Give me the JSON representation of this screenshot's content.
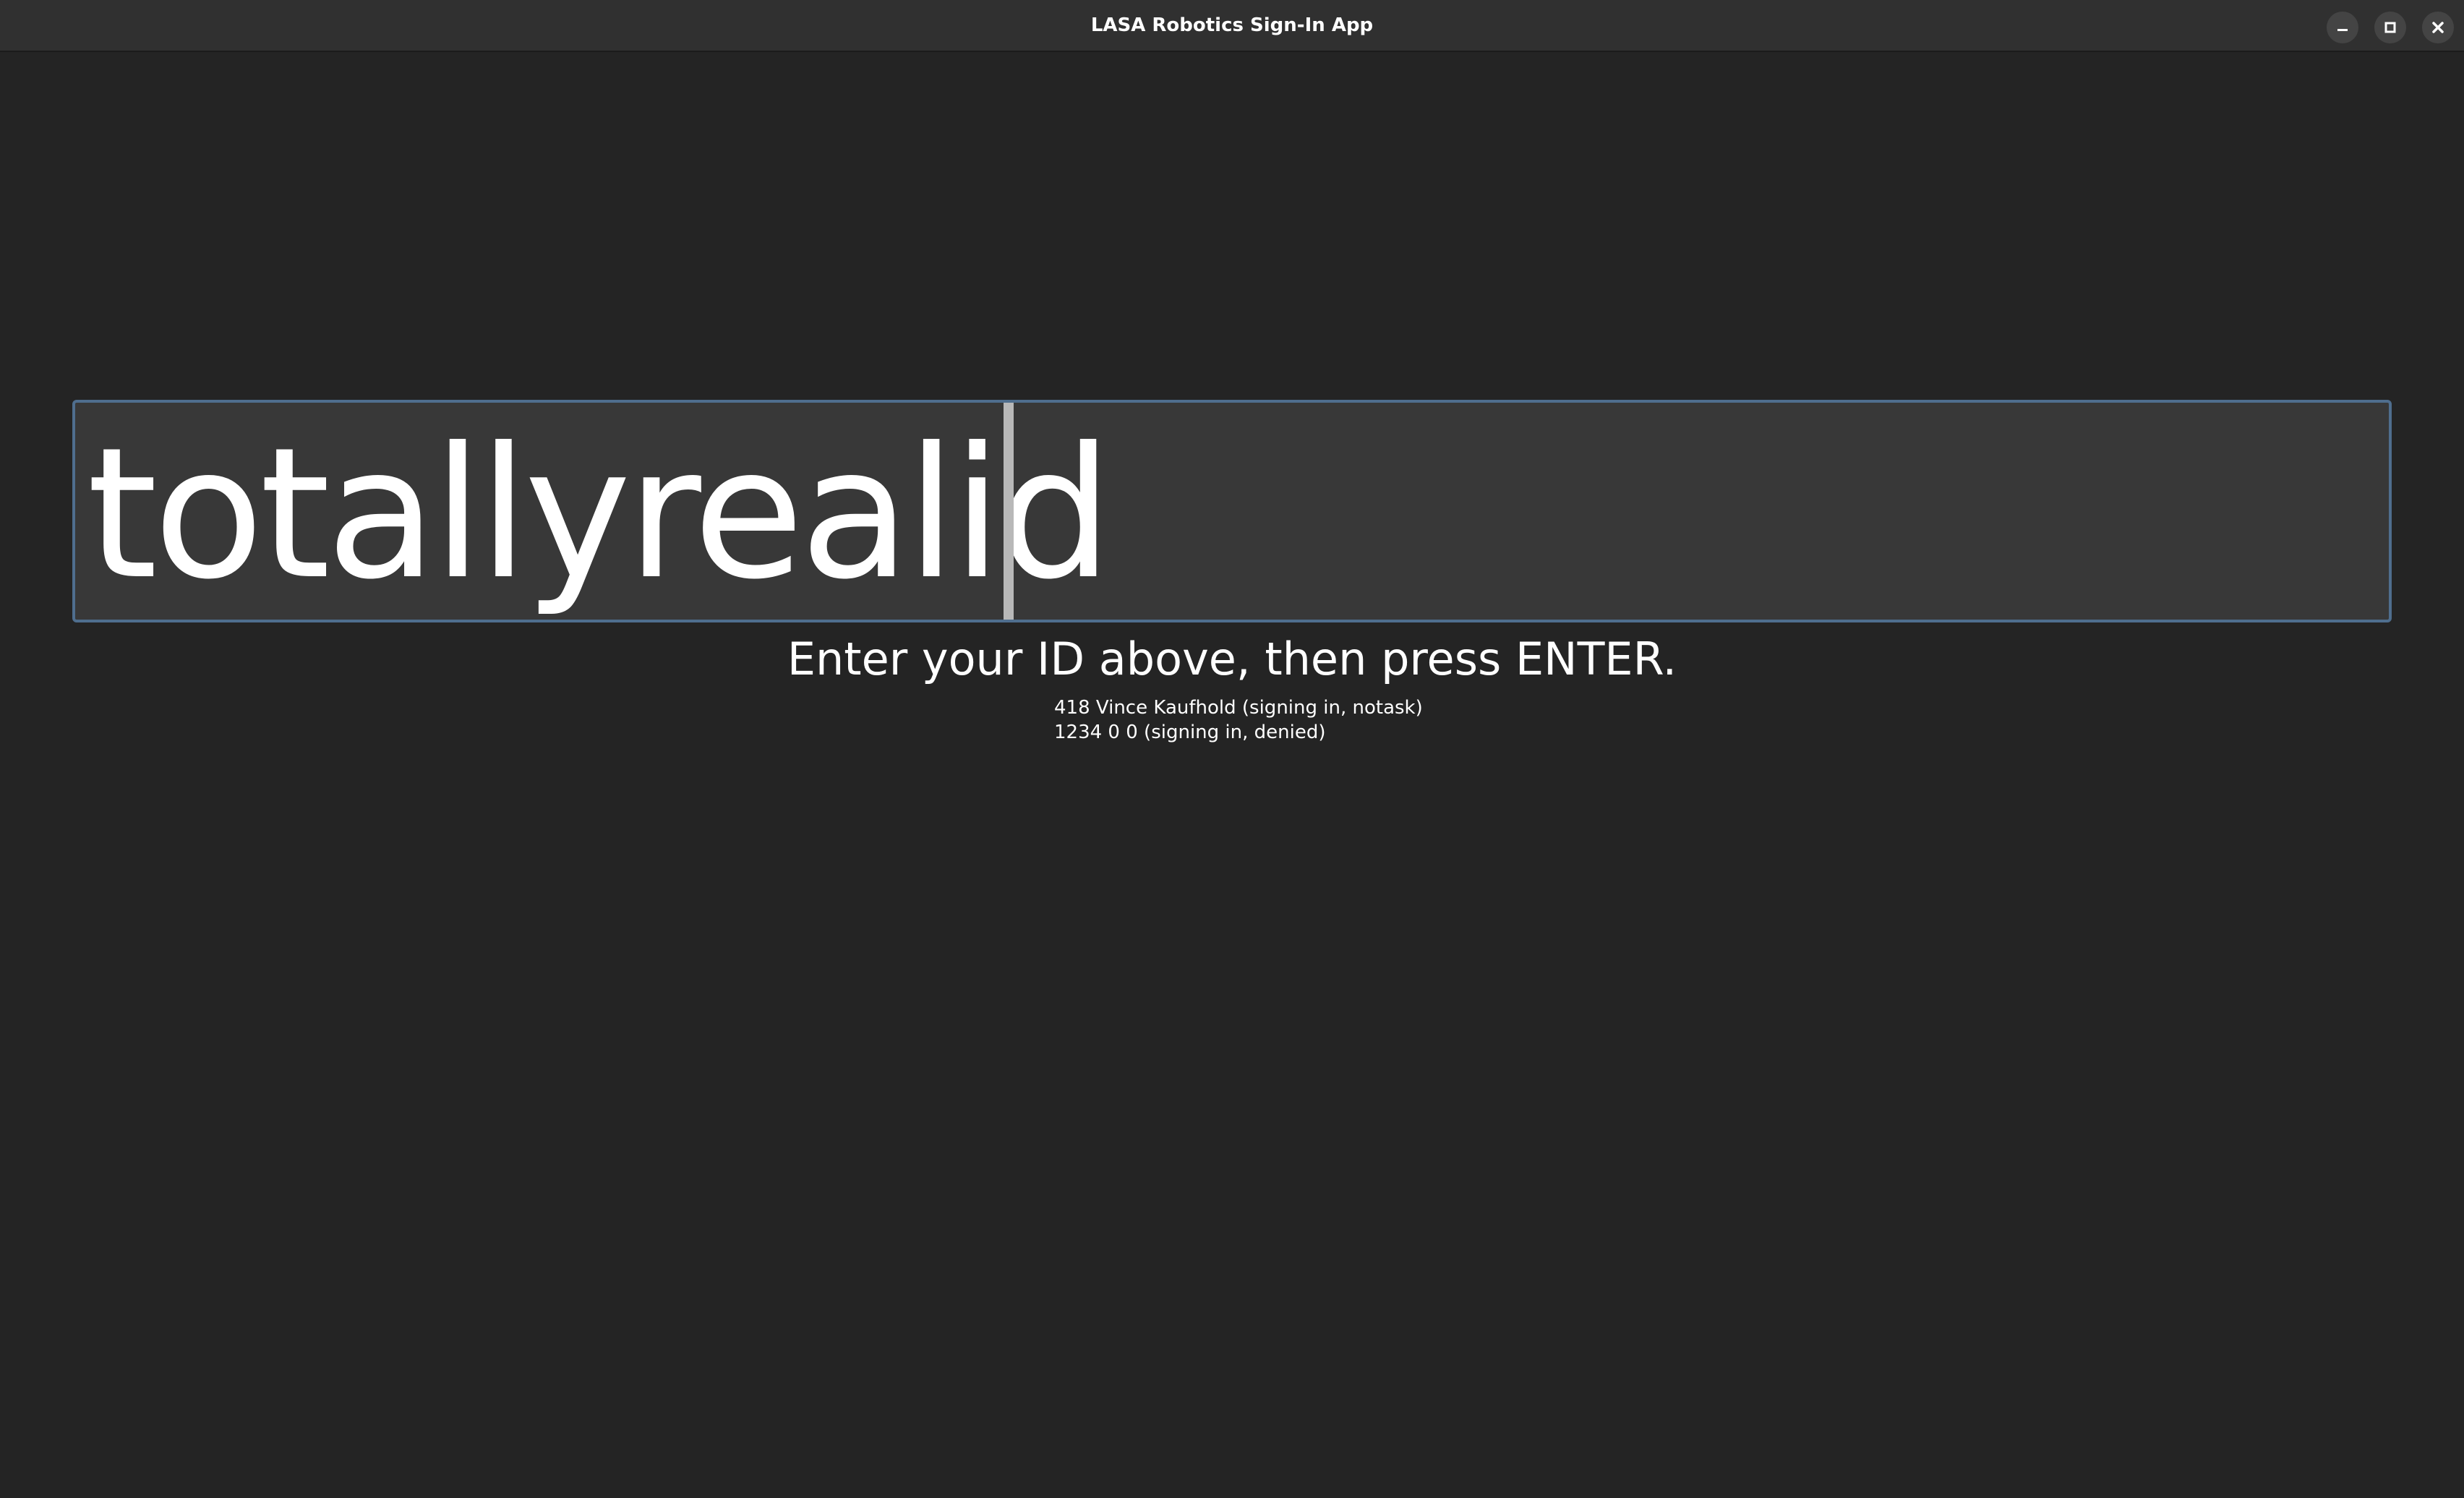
{
  "window": {
    "title": "LASA Robotics Sign-In App",
    "controls": {
      "minimize_icon": "minimize-icon",
      "maximize_icon": "maximize-icon",
      "close_icon": "close-icon"
    }
  },
  "id_input": {
    "value": "totallyrealid"
  },
  "prompt": {
    "text": "Enter your ID above, then press ENTER."
  },
  "log": {
    "entries": [
      "418 Vince Kaufhold (signing in, notask)",
      "1234 0 0 (signing in, denied)"
    ]
  },
  "colors": {
    "background": "#242424",
    "titlebar": "#303030",
    "input_background": "#383838",
    "input_border": "#4f6e8e",
    "text": "#ffffff"
  }
}
